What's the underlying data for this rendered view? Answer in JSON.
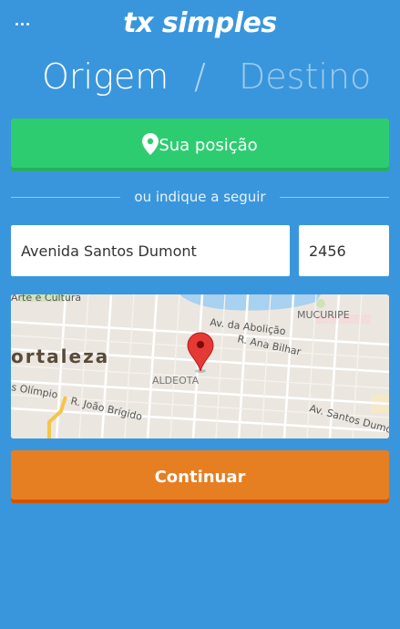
{
  "header": {
    "menu_icon": "more-horizontal-icon",
    "logo": "tx simples"
  },
  "tabs": {
    "origem": "Origem",
    "separator": "/",
    "destino": "Destino"
  },
  "position_button": {
    "label": "Sua posição",
    "icon": "location-pin-icon"
  },
  "divider_text": "ou indique a seguir",
  "address": {
    "street_value": "Avenida Santos Dumont",
    "number_value": "2456"
  },
  "map": {
    "labels": {
      "arte": "Arte e Cultura",
      "abolicao": "Av. da Abolição",
      "mucuripe": "MUCURIPE",
      "ana_bilhar": "R. Ana Bilhar",
      "fortaleza": "ortaleza",
      "aldeota": "ALDEOTA",
      "olimpio": "s Olímpio",
      "joao_brigido": "R. João Brígido",
      "santos_dumont": "Av. Santos Dumo"
    },
    "marker_icon": "map-marker-icon"
  },
  "continue_button": {
    "label": "Continuar"
  },
  "colors": {
    "background": "#3a96dc",
    "green": "#2ecc71",
    "orange": "#e67e22"
  }
}
